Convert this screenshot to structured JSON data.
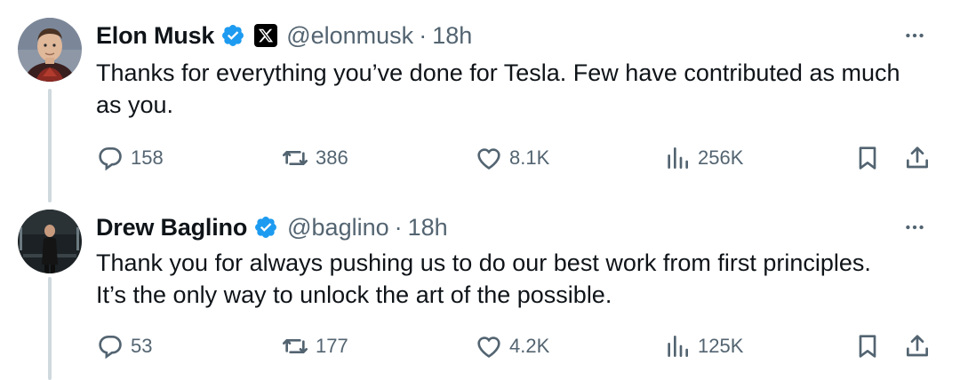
{
  "tweets": [
    {
      "author": "Elon Musk",
      "handle": "@elonmusk",
      "separator": "·",
      "time": "18h",
      "affiliate_icon": "x-logo-icon",
      "text_lines": [
        "Thanks for everything you’ve done for Tesla. Few have contributed as much",
        "as you."
      ],
      "replies": "158",
      "reposts": "386",
      "likes": "8.1K",
      "views": "256K"
    },
    {
      "author": "Drew Baglino",
      "handle": "@baglino",
      "separator": "·",
      "time": "18h",
      "text_lines": [
        "Thank you for always pushing us to do our best work from first principles.",
        "It’s the only way to unlock the art of the possible."
      ],
      "replies": "53",
      "reposts": "177",
      "likes": "4.2K",
      "views": "125K"
    }
  ],
  "colors": {
    "verified": "#1d9bf0",
    "muted": "#536471",
    "text": "#0f1419",
    "thread_line": "#cfd9de"
  },
  "icons": [
    "verified-badge-icon",
    "x-logo-icon",
    "more-icon",
    "reply-icon",
    "repost-icon",
    "like-icon",
    "views-icon",
    "bookmark-icon",
    "share-icon"
  ]
}
